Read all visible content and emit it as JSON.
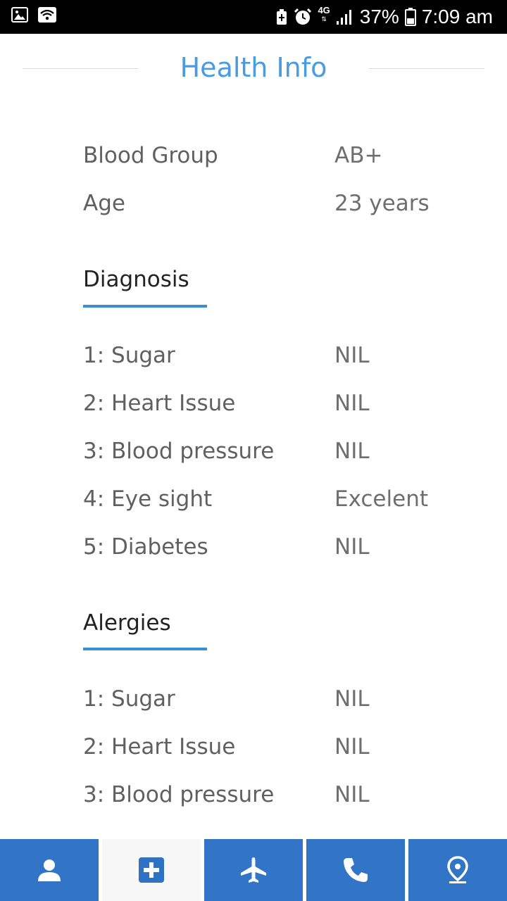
{
  "status_bar": {
    "network": "4G",
    "battery": "37%",
    "time": "7:09 am"
  },
  "header": {
    "title": "Health Info"
  },
  "basic_info": [
    {
      "label": "Blood Group",
      "value": "AB+"
    },
    {
      "label": "Age",
      "value": "23 years"
    }
  ],
  "diagnosis": {
    "title": "Diagnosis",
    "items": [
      {
        "label": "1: Sugar",
        "value": "NIL"
      },
      {
        "label": "2: Heart Issue",
        "value": "NIL"
      },
      {
        "label": "3: Blood pressure",
        "value": "NIL"
      },
      {
        "label": "4: Eye sight",
        "value": "Excelent"
      },
      {
        "label": "5: Diabetes",
        "value": "NIL"
      }
    ]
  },
  "allergies": {
    "title": "Alergies",
    "items": [
      {
        "label": "1: Sugar",
        "value": "NIL"
      },
      {
        "label": "2: Heart Issue",
        "value": "NIL"
      },
      {
        "label": "3: Blood pressure",
        "value": "NIL"
      }
    ]
  },
  "bottom_nav": {
    "items": [
      {
        "icon": "person-icon",
        "active": false
      },
      {
        "icon": "medical-cross-icon",
        "active": true
      },
      {
        "icon": "airplane-icon",
        "active": false
      },
      {
        "icon": "phone-icon",
        "active": false
      },
      {
        "icon": "location-pin-icon",
        "active": false
      }
    ]
  },
  "colors": {
    "title": "#4a9be0",
    "accent_underline": "#3b8ed0",
    "nav_background": "#3275c6",
    "nav_active_background": "#f7f7f7"
  }
}
